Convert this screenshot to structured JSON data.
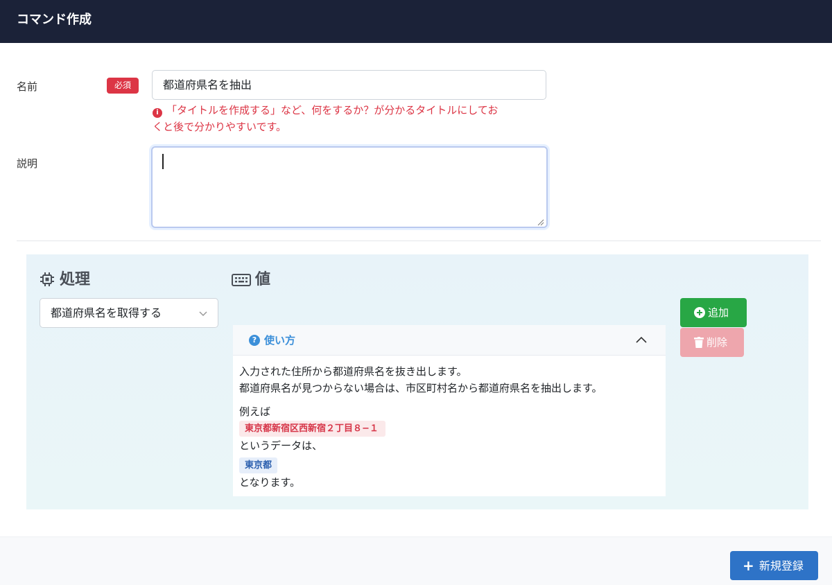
{
  "header": {
    "title": "コマンド作成"
  },
  "form": {
    "name_label": "名前",
    "required_badge": "必須",
    "name_value": "都道府県名を抽出",
    "name_hint_line1": "「タイトルを作成する」など、何をするか？が分かるタイトルにしてお",
    "name_hint_line2": "くと後で分かりやすいです。",
    "description_label": "説明",
    "description_value": ""
  },
  "process": {
    "title": "処理",
    "selected": "都道府県名を取得する"
  },
  "value": {
    "title": "値",
    "add_button": "追加",
    "delete_button": "削除"
  },
  "usage": {
    "title": "使い方",
    "line1": "入力された住所から都道府県名を抜き出します。",
    "line2": "都道府県名が見つからない場合は、市区町村名から都道府県名を抽出します。",
    "example_label": "例えば",
    "example_input": "東京都新宿区西新宿２丁目８−１",
    "example_mid": "というデータは、",
    "example_output": "東京都",
    "example_end": "となります。"
  },
  "footer": {
    "submit_button": "新規登録"
  },
  "colors": {
    "header_bg": "#1b2238",
    "required": "#dc3545",
    "add": "#28a745",
    "delete": "#eea6ad",
    "primary": "#2e73c7",
    "usage_accent": "#3b8fd9"
  },
  "icons": [
    "chip-icon",
    "keyboard-icon",
    "chevron-down-icon",
    "plus-circle-icon",
    "trash-icon",
    "question-icon",
    "chevron-up-icon",
    "info-icon",
    "plus-icon"
  ]
}
